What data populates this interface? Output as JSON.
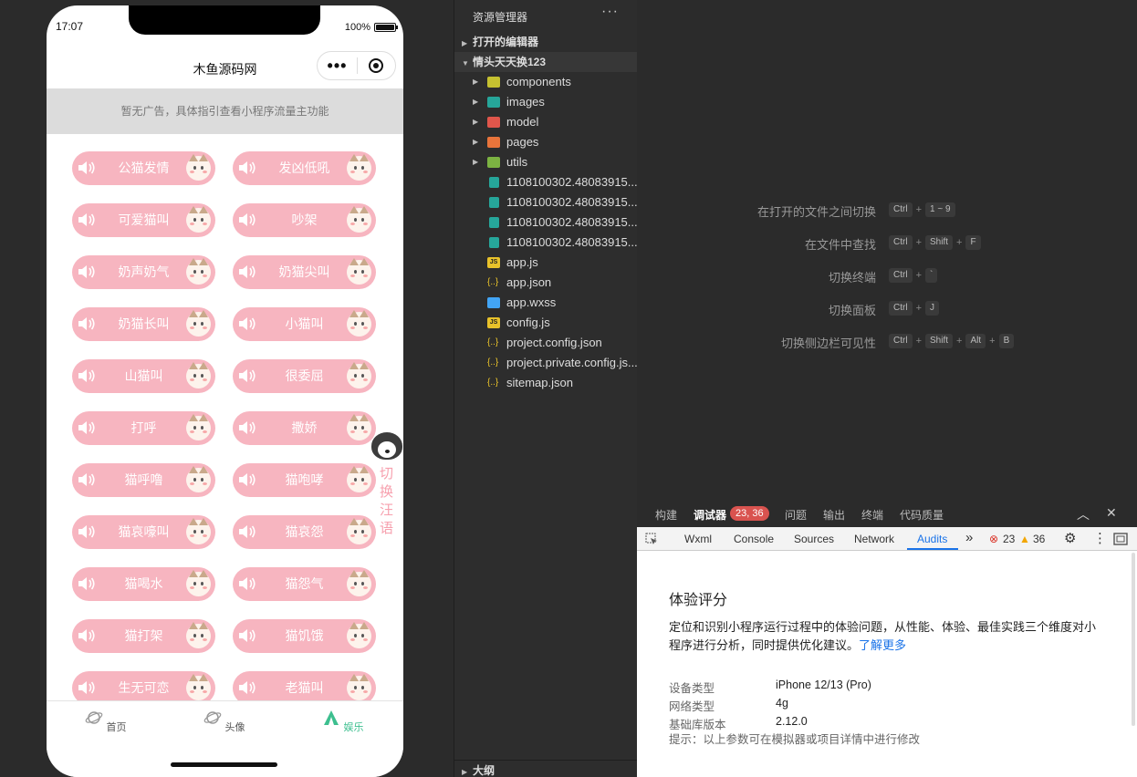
{
  "status_bar": {
    "time": "17:07",
    "battery": "100%"
  },
  "nav": {
    "title": "木鱼源码网"
  },
  "ad": {
    "text": "暂无广告，具体指引查看小程序流量主功能"
  },
  "sounds": [
    "公猫发情",
    "发凶低吼",
    "可爱猫叫",
    "吵架",
    "奶声奶气",
    "奶猫尖叫",
    "奶猫长叫",
    "小猫叫",
    "山猫叫",
    "很委屈",
    "打呼",
    "撒娇",
    "猫呼噜",
    "猫咆哮",
    "猫哀嚎叫",
    "猫哀怨",
    "猫喝水",
    "猫怨气",
    "猫打架",
    "猫饥饿",
    "生无可恋",
    "老猫叫"
  ],
  "switch_label": "切换汪语",
  "tabbar": [
    {
      "label": "首页",
      "icon": "planet-icon"
    },
    {
      "label": "头像",
      "icon": "planet-icon"
    },
    {
      "label": "娱乐",
      "icon": "tent-icon"
    }
  ],
  "explorer": {
    "title": "资源管理器",
    "more": "···",
    "open_editors": "打开的编辑器",
    "project": "情头天天换123",
    "outline": "大纲",
    "folders": [
      {
        "name": "components",
        "color": "#c5c130"
      },
      {
        "name": "images",
        "color": "#26a69a"
      },
      {
        "name": "model",
        "color": "#e0564b"
      },
      {
        "name": "pages",
        "color": "#e8743b"
      },
      {
        "name": "utils",
        "color": "#7cb342"
      }
    ],
    "files": [
      {
        "name": "1108100302.48083915...",
        "icon": "image-file-icon"
      },
      {
        "name": "1108100302.48083915...",
        "icon": "image-file-icon"
      },
      {
        "name": "1108100302.48083915...",
        "icon": "image-file-icon"
      },
      {
        "name": "1108100302.48083915...",
        "icon": "image-file-icon"
      },
      {
        "name": "app.js",
        "icon": "js-file-icon"
      },
      {
        "name": "app.json",
        "icon": "json-file-icon"
      },
      {
        "name": "app.wxss",
        "icon": "css-file-icon"
      },
      {
        "name": "config.js",
        "icon": "js-file-icon"
      },
      {
        "name": "project.config.json",
        "icon": "json-file-icon"
      },
      {
        "name": "project.private.config.js...",
        "icon": "json-file-icon"
      },
      {
        "name": "sitemap.json",
        "icon": "json-file-icon"
      }
    ]
  },
  "shortcuts": [
    {
      "label": "在打开的文件之间切换",
      "keys": [
        "Ctrl",
        "1 ~ 9"
      ]
    },
    {
      "label": "在文件中查找",
      "keys": [
        "Ctrl",
        "Shift",
        "F"
      ]
    },
    {
      "label": "切换终端",
      "keys": [
        "Ctrl",
        "`"
      ]
    },
    {
      "label": "切换面板",
      "keys": [
        "Ctrl",
        "J"
      ]
    },
    {
      "label": "切换侧边栏可见性",
      "keys": [
        "Ctrl",
        "Shift",
        "Alt",
        "B"
      ]
    }
  ],
  "panel": {
    "tabs": [
      "构建",
      "调试器",
      "问题",
      "输出",
      "终端",
      "代码质量"
    ],
    "badge": "23, 36",
    "devtools_tabs": [
      "Wxml",
      "Console",
      "Sources",
      "Network",
      "Audits"
    ],
    "errors": "23",
    "warnings": "36",
    "more": "»"
  },
  "audits": {
    "title": "体验评分",
    "desc": "定位和识别小程序运行过程中的体验问题，从性能、体验、最佳实践三个维度对小程序进行分析，同时提供优化建议。",
    "link": "了解更多",
    "rows": [
      {
        "k": "设备类型",
        "v": "iPhone 12/13 (Pro)"
      },
      {
        "k": "网络类型",
        "v": "4g"
      },
      {
        "k": "基础库版本",
        "v": "2.12.0"
      }
    ],
    "tip": "提示：以上参数可在模拟器或项目详情中进行修改"
  }
}
